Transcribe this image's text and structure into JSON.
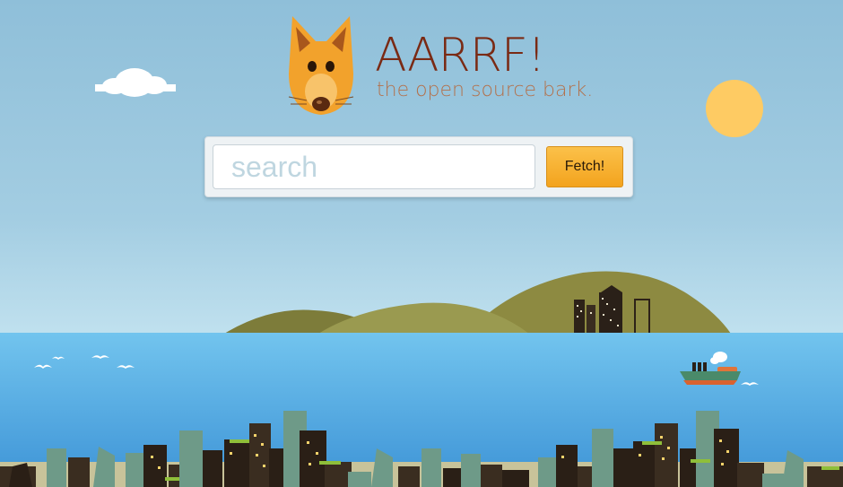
{
  "brand": {
    "title": "AARRF!",
    "tagline": "the open source bark."
  },
  "search": {
    "placeholder": "search",
    "value": "",
    "button_label": "Fetch!"
  },
  "icons": {
    "logo": "fox-head-icon",
    "cloud": "cloud-icon",
    "sun": "sun-icon",
    "ship": "ship-icon"
  },
  "colors": {
    "title": "#7a2a14",
    "tagline": "#b3714c",
    "button": "#f3a31e",
    "sun": "#fecb63",
    "water": "#5fb2e6",
    "hill": "#8a8b43",
    "fox": "#f2a22c"
  }
}
